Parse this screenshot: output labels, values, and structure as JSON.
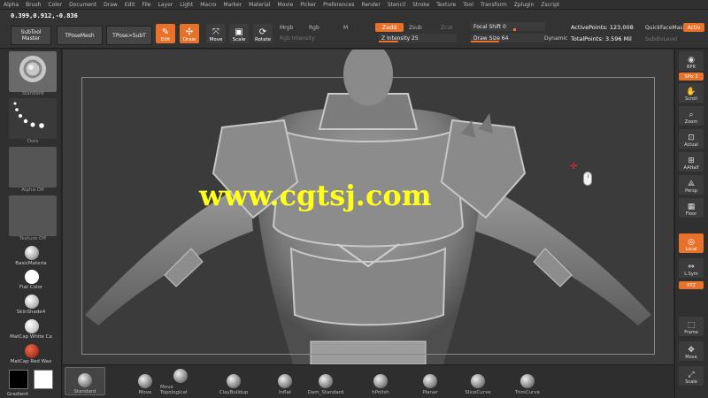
{
  "menu": [
    "Alpha",
    "Brush",
    "Color",
    "Document",
    "Draw",
    "Edit",
    "File",
    "Layer",
    "Light",
    "Macro",
    "Marker",
    "Material",
    "Movie",
    "Picker",
    "Preferences",
    "Render",
    "Stencil",
    "Stroke",
    "Texture",
    "Tool",
    "Transform",
    "Zplugin",
    "Zscript"
  ],
  "coords": "0.399,0.912,-0.836",
  "toolbar": {
    "subtool_master": "SubTool Master",
    "tpose_mesh": "TPoseMesh",
    "tpose_sub": "TPose>SubT",
    "edit": "Edit",
    "draw": "Draw",
    "move": "Move",
    "scale": "Scale",
    "rotate": "Rotate",
    "mrgb": "Mrgb",
    "rgb": "Rgb",
    "m": "M",
    "rgb_intensity": "Rgb Intensity",
    "zadd": "Zadd",
    "zsub": "Zsub",
    "zcut": "Zcut",
    "z_intensity": "Z Intensity 25",
    "focal_shift": "Focal Shift 0",
    "draw_size": "Draw Size 64",
    "dynamic": "Dynamic",
    "active_points": "ActivePoints: 123,008",
    "total_points": "TotalPoints: 3.596 Mil",
    "quickfacemask": "QuickFaceMask",
    "activ": "Activ",
    "subdivlevel": "SubdivLevel"
  },
  "left": {
    "standard": "Standard",
    "dots": "Dots",
    "alpha_off": "Alpha Off",
    "texture_off": "Texture Off",
    "materials": [
      {
        "name": "BasicMateria",
        "color": "#d8d8d8"
      },
      {
        "name": "Flat Color",
        "color": "#ffffff"
      },
      {
        "name": "SkinShade4",
        "color": "#e4e4e4"
      },
      {
        "name": "MatCap White Ca",
        "color": "#f0f0f0"
      },
      {
        "name": "MatCap Red Wax",
        "color": "#b23a22"
      }
    ],
    "swatch_main": "#000000",
    "swatch_secondary": "#ffffff",
    "gradient": "Gradient"
  },
  "right": {
    "bpr": "BPR",
    "spix": "SPix 3",
    "scroll": "Scroll",
    "zoom": "Zoom",
    "actual": "Actual",
    "aahalf": "AAHalf",
    "persp": "Persp",
    "floor": "Floor",
    "local": "Local",
    "lsym": "L.Sym",
    "xyz": "XYZ",
    "frame": "Frame",
    "move": "Move",
    "scale": "Scale"
  },
  "watermark": "www.cgtsj.com",
  "brushes": [
    "Standard",
    "Move",
    "Move Topological",
    "ClayBuildup",
    "Inflat",
    "Dam_Standard",
    "hPolish",
    "Planar",
    "SliceCurve",
    "TrimCurve"
  ],
  "colors": {
    "accent": "#e8722a",
    "watermark": "#ffff1a"
  }
}
